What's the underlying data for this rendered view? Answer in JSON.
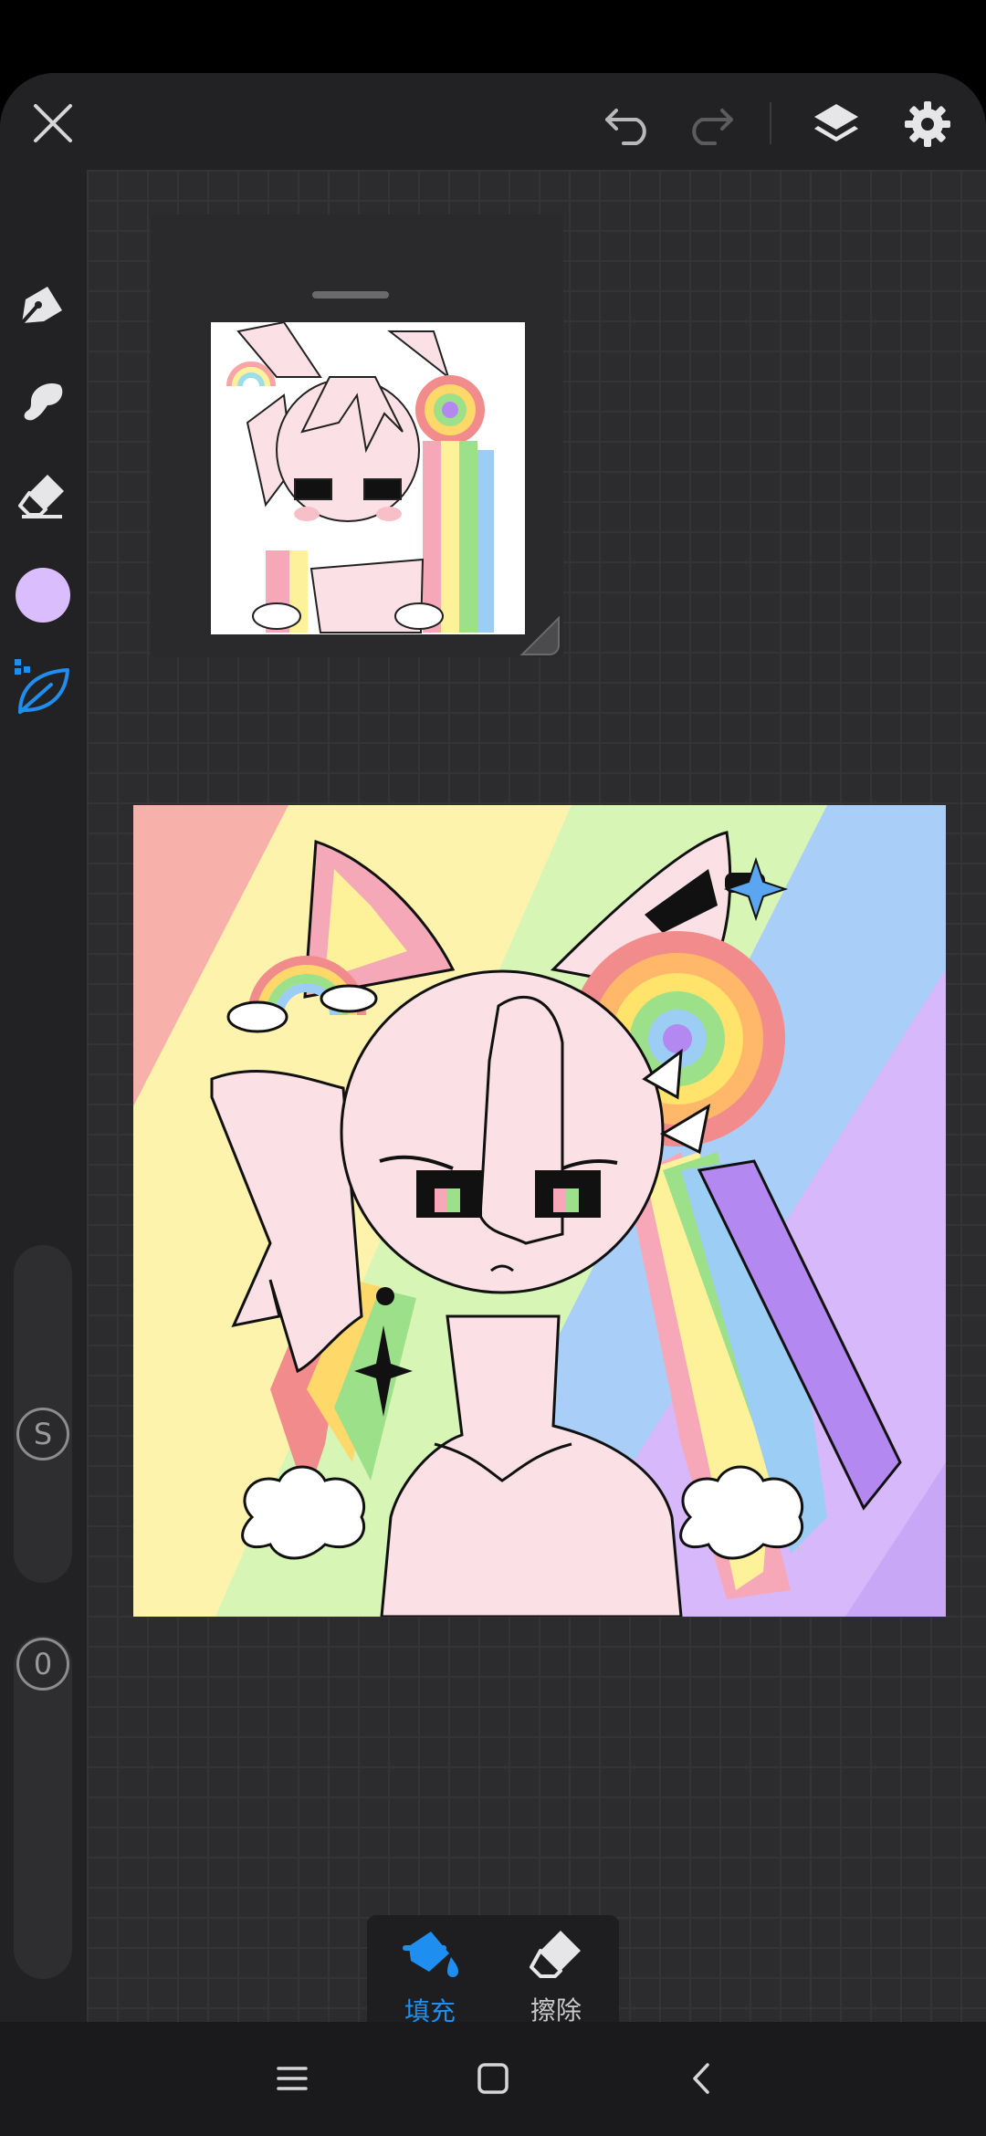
{
  "topbar": {
    "close_icon": "close-icon",
    "undo_icon": "undo-icon",
    "redo_icon": "redo-icon",
    "layers_icon": "layers-icon",
    "settings_icon": "gear-icon"
  },
  "sidebar": {
    "tools": [
      "pen-icon",
      "smudge-icon",
      "eraser-icon",
      "color-swatch",
      "fill-leaf-icon"
    ],
    "active_tool": "fill-leaf-icon",
    "current_color": "#d9bdfc",
    "size_slider_label": "S",
    "opacity_slider_label": "0"
  },
  "reference": {
    "image": "reference-drawing-thumbnail"
  },
  "artwork": {
    "image": "rainbow-cat-character-drawing"
  },
  "actions": {
    "fill_label": "填充",
    "erase_label": "擦除",
    "active": "fill",
    "accent": "#1e8ff0"
  },
  "navbar": {
    "menu_icon": "menu-icon",
    "home_icon": "home-icon",
    "back_icon": "back-icon"
  }
}
